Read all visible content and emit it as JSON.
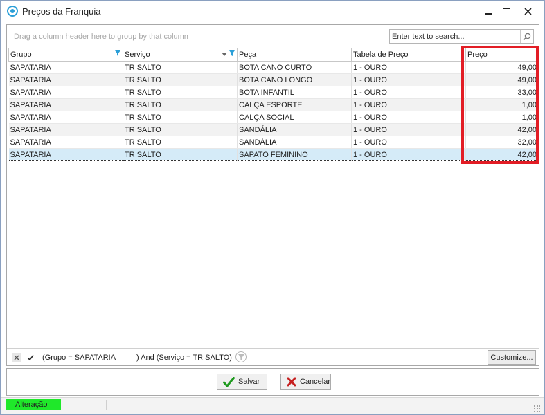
{
  "window": {
    "title": "Preços da Franquia",
    "controls": {
      "minimize": "minimize",
      "maximize": "maximize",
      "close": "close"
    }
  },
  "grid": {
    "group_hint": "Drag a column header here to group by that column",
    "search_placeholder": "Enter text to search...",
    "columns": [
      "Grupo",
      "Serviço",
      "Peça",
      "Tabela de Preço",
      "Preço"
    ],
    "rows": [
      [
        "SAPATARIA",
        "TR SALTO",
        "BOTA CANO CURTO",
        "1 - OURO",
        "49,00"
      ],
      [
        "SAPATARIA",
        "TR SALTO",
        "BOTA CANO LONGO",
        "1 - OURO",
        "49,00"
      ],
      [
        "SAPATARIA",
        "TR SALTO",
        "BOTA INFANTIL",
        "1 - OURO",
        "33,00"
      ],
      [
        "SAPATARIA",
        "TR SALTO",
        "CALÇA ESPORTE",
        "1 - OURO",
        "1,00"
      ],
      [
        "SAPATARIA",
        "TR SALTO",
        "CALÇA SOCIAL",
        "1 - OURO",
        "1,00"
      ],
      [
        "SAPATARIA",
        "TR SALTO",
        "SANDÁLIA",
        "1 - OURO",
        "42,00"
      ],
      [
        "SAPATARIA",
        "TR SALTO",
        "SANDÁLIA",
        "1 - OURO",
        "32,00"
      ],
      [
        "SAPATARIA",
        "TR SALTO",
        "SAPATO FEMININO",
        "1 - OURO",
        "42,00"
      ]
    ],
    "selected_row": 7,
    "highlight_color": "#e21d25"
  },
  "filter_bar": {
    "expression": "(Grupo = SAPATARIA          ) And (Serviço = TR SALTO)",
    "enabled": true,
    "customize_label": "Customize..."
  },
  "buttons": {
    "save_label": "Salvar",
    "cancel_label": "Cancelar"
  },
  "status": {
    "mode": "Alteração",
    "mode_color": "#1fe82a"
  }
}
